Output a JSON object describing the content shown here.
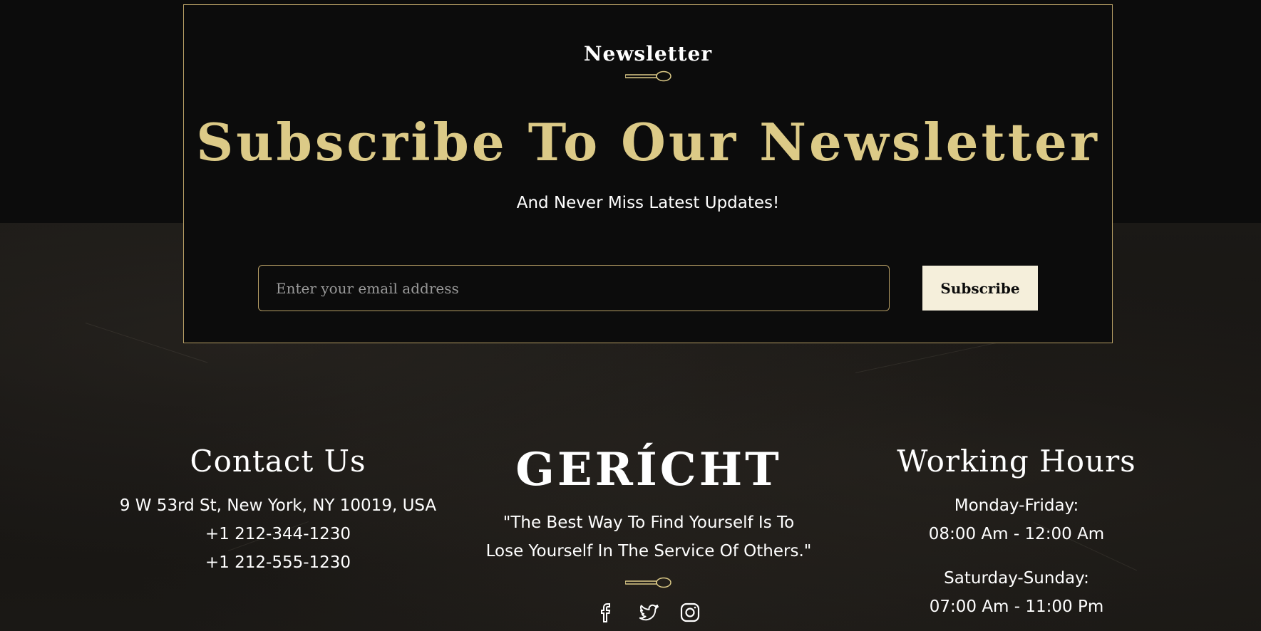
{
  "newsletter": {
    "subtitle": "Newsletter",
    "title": "Subscribe To Our Newsletter",
    "tagline": "And Never Miss Latest Updates!",
    "email_placeholder": "Enter your email address",
    "email_value": "",
    "subscribe_label": "Subscribe"
  },
  "footer": {
    "contact": {
      "heading": "Contact Us",
      "address": "9 W 53rd St, New York, NY 10019, USA",
      "phone1": "+1 212-344-1230",
      "phone2": "+1 212-555-1230"
    },
    "brand": {
      "logo": "GERÍCHT",
      "quote_line1": "\"The Best Way To Find Yourself Is To",
      "quote_line2": "Lose Yourself In The Service Of Others.\"",
      "social_icons": [
        "facebook-icon",
        "twitter-icon",
        "instagram-icon"
      ]
    },
    "hours": {
      "heading": "Working Hours",
      "weekdays_label": "Monday-Friday:",
      "weekdays_time": "08:00 Am - 12:00 Am",
      "weekend_label": "Saturday-Sunday:",
      "weekend_time": "07:00 Am - 11:00 Pm"
    }
  },
  "colors": {
    "gold": "#dcca87",
    "border_gold": "#b59d64",
    "cream": "#f5efdb",
    "background": "#0c0c0c",
    "text": "#ffffff"
  }
}
